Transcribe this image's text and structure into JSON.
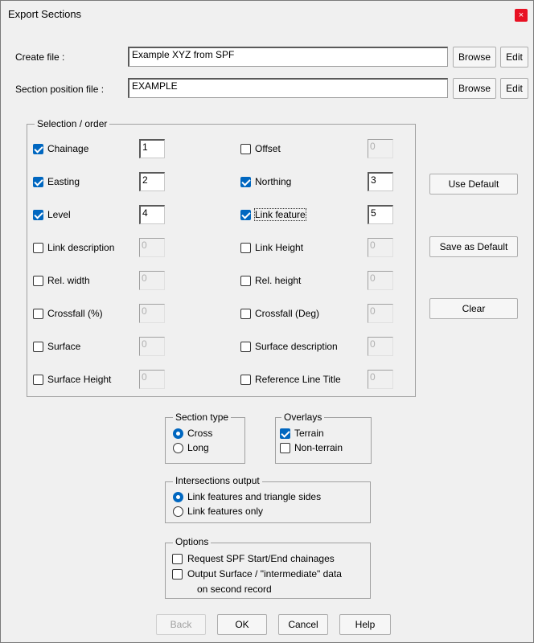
{
  "window": {
    "title": "Export Sections",
    "close": "×"
  },
  "files": {
    "create_label": "Create file :",
    "create_value": "Example XYZ from SPF",
    "section_label": "Section position file :",
    "section_value": "EXAMPLE",
    "browse": "Browse",
    "edit": "Edit"
  },
  "selection": {
    "title": "Selection / order",
    "items": [
      {
        "label": "Chainage",
        "checked": true,
        "value": "1"
      },
      {
        "label": "Offset",
        "checked": false,
        "value": "0"
      },
      {
        "label": "Easting",
        "checked": true,
        "value": "2"
      },
      {
        "label": "Northing",
        "checked": true,
        "value": "3"
      },
      {
        "label": "Level",
        "checked": true,
        "value": "4"
      },
      {
        "label": "Link feature",
        "checked": true,
        "value": "5"
      },
      {
        "label": "Link description",
        "checked": false,
        "value": "0"
      },
      {
        "label": "Link Height",
        "checked": false,
        "value": "0"
      },
      {
        "label": "Rel. width",
        "checked": false,
        "value": "0"
      },
      {
        "label": "Rel. height",
        "checked": false,
        "value": "0"
      },
      {
        "label": "Crossfall (%)",
        "checked": false,
        "value": "0"
      },
      {
        "label": "Crossfall (Deg)",
        "checked": false,
        "value": "0"
      },
      {
        "label": "Surface",
        "checked": false,
        "value": "0"
      },
      {
        "label": "Surface description",
        "checked": false,
        "value": "0"
      },
      {
        "label": "Surface Height",
        "checked": false,
        "value": "0"
      },
      {
        "label": "Reference Line Title",
        "checked": false,
        "value": "0"
      }
    ]
  },
  "side_buttons": {
    "use_default": "Use Default",
    "save_default": "Save as Default",
    "clear": "Clear"
  },
  "section_type": {
    "title": "Section type",
    "cross": "Cross",
    "long": "Long",
    "selected": "cross"
  },
  "overlays": {
    "title": "Overlays",
    "terrain": "Terrain",
    "terrain_checked": true,
    "non_terrain": "Non-terrain",
    "non_terrain_checked": false
  },
  "intersections": {
    "title": "Intersections output",
    "opt1": "Link features and triangle sides",
    "opt2": "Link features only",
    "selected": "opt1"
  },
  "options": {
    "title": "Options",
    "opt1": "Request SPF Start/End chainages",
    "opt1_checked": false,
    "opt2_line1": "Output Surface / \"intermediate\" data",
    "opt2_line2": "on second record",
    "opt2_checked": false
  },
  "footer": {
    "back": "Back",
    "ok": "OK",
    "cancel": "Cancel",
    "help": "Help"
  }
}
